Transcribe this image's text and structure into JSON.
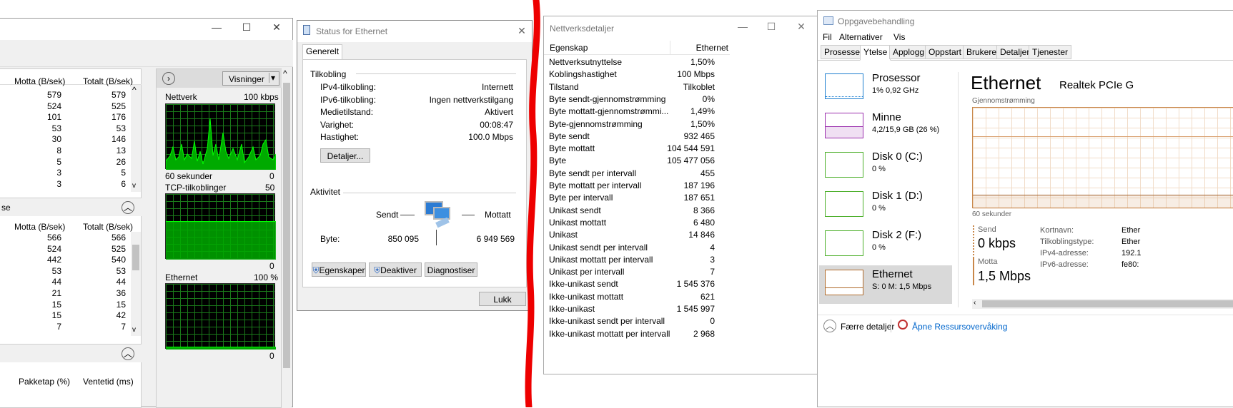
{
  "resmon": {
    "top_table": {
      "headers": [
        "Motta (B/sek)",
        "Totalt (B/sek)"
      ],
      "rows": [
        [
          "579",
          "579"
        ],
        [
          "524",
          "525"
        ],
        [
          "101",
          "176"
        ],
        [
          "53",
          "53"
        ],
        [
          "30",
          "146"
        ],
        [
          "8",
          "13"
        ],
        [
          "5",
          "26"
        ],
        [
          "3",
          "5"
        ],
        [
          "3",
          "6"
        ]
      ]
    },
    "mid_section": {
      "title_fragment": "se",
      "headers": [
        "Motta (B/sek)",
        "Totalt (B/sek)"
      ],
      "rows": [
        [
          "566",
          "566"
        ],
        [
          "524",
          "525"
        ],
        [
          "442",
          "540"
        ],
        [
          "53",
          "53"
        ],
        [
          "44",
          "44"
        ],
        [
          "21",
          "36"
        ],
        [
          "15",
          "15"
        ],
        [
          "15",
          "42"
        ],
        [
          "7",
          "7"
        ]
      ]
    },
    "bottom_headers": [
      "Pakketap (%)",
      "Ventetid (ms)"
    ],
    "views_button": "Visninger",
    "graphs": [
      {
        "title": "Nettverk",
        "scale": "100 kbps",
        "footer_left": "60 sekunder",
        "footer_right": "0"
      },
      {
        "title": "TCP-tilkoblinger",
        "scale": "50",
        "footer_right": "0"
      },
      {
        "title": "Ethernet",
        "scale": "100 %",
        "footer_right": "0"
      }
    ]
  },
  "status": {
    "title": "Status for Ethernet",
    "tab": "Generelt",
    "connection_heading": "Tilkobling",
    "fields": [
      {
        "label": "IPv4-tilkobling:",
        "value": "Internett"
      },
      {
        "label": "IPv6-tilkobling:",
        "value": "Ingen nettverkstilgang"
      },
      {
        "label": "Medietilstand:",
        "value": "Aktivert"
      },
      {
        "label": "Varighet:",
        "value": "00:08:47"
      },
      {
        "label": "Hastighet:",
        "value": "100.0 Mbps"
      }
    ],
    "details_btn": "Detaljer...",
    "activity_heading": "Aktivitet",
    "sent_label": "Sendt",
    "recv_label": "Mottatt",
    "bytes_label": "Byte:",
    "bytes_sent": "850 095",
    "bytes_recv": "6 949 569",
    "btn_properties": "Egenskaper",
    "btn_disable": "Deaktiver",
    "btn_diagnose": "Diagnostiser",
    "btn_close": "Lukk"
  },
  "details": {
    "title": "Nettverksdetaljer",
    "col1": "Egenskap",
    "col2": "Ethernet",
    "rows": [
      [
        "Nettverksutnyttelse",
        "1,50%"
      ],
      [
        "Koblingshastighet",
        "100 Mbps"
      ],
      [
        "Tilstand",
        "Tilkoblet"
      ],
      [
        "Byte sendt-gjennomstrømming",
        "0%"
      ],
      [
        "Byte mottatt-gjennomstrømmi...",
        "1,49%"
      ],
      [
        "Byte-gjennomstrømming",
        "1,50%"
      ],
      [
        "Byte sendt",
        "932 465"
      ],
      [
        "Byte mottatt",
        "104 544 591"
      ],
      [
        "Byte",
        "105 477 056"
      ],
      [
        "Byte sendt per intervall",
        "455"
      ],
      [
        "Byte mottatt per intervall",
        "187 196"
      ],
      [
        "Byte per intervall",
        "187 651"
      ],
      [
        "Unikast sendt",
        "8 366"
      ],
      [
        "Unikast mottatt",
        "6 480"
      ],
      [
        "Unikast",
        "14 846"
      ],
      [
        "Unikast sendt per intervall",
        "4"
      ],
      [
        "Unikast mottatt per intervall",
        "3"
      ],
      [
        "Unikast per intervall",
        "7"
      ],
      [
        "Ikke-unikast sendt",
        "1 545 376"
      ],
      [
        "Ikke-unikast mottatt",
        "621"
      ],
      [
        "Ikke-unikast",
        "1 545 997"
      ],
      [
        "Ikke-unikast sendt per intervall",
        "0"
      ],
      [
        "Ikke-unikast mottatt per intervall",
        "2 968"
      ]
    ]
  },
  "taskmgr": {
    "title": "Oppgavebehandling",
    "menu": [
      "Fil",
      "Alternativer",
      "Vis"
    ],
    "tabs": [
      "Prosesser",
      "Ytelse",
      "Applogg",
      "Oppstart",
      "Brukere",
      "Detaljer",
      "Tjenester"
    ],
    "perf_items": [
      {
        "name": "Prosessor",
        "sub": "1% 0,92 GHz",
        "color": "#1e7fd0"
      },
      {
        "name": "Minne",
        "sub": "4,2/15,9 GB (26 %)",
        "color": "#9b2fae"
      },
      {
        "name": "Disk 0 (C:)",
        "sub": "0 %",
        "color": "#4caf2a"
      },
      {
        "name": "Disk 1 (D:)",
        "sub": "0 %",
        "color": "#4caf2a"
      },
      {
        "name": "Disk 2 (F:)",
        "sub": "0 %",
        "color": "#4caf2a"
      },
      {
        "name": "Ethernet",
        "sub": "S: 0 M: 1,5 Mbps",
        "color": "#b06a2a"
      }
    ],
    "heading": "Ethernet",
    "adapter": "Realtek PCIe G",
    "throughput_label": "Gjennomstrømming",
    "graph_footer": "60 sekunder",
    "send_label": "Send",
    "send_value": "0 kbps",
    "recv_label": "Motta",
    "recv_value": "1,5 Mbps",
    "info": [
      {
        "label": "Kortnavn:",
        "value": "Ether"
      },
      {
        "label": "Tilkoblingstype:",
        "value": "Ether"
      },
      {
        "label": "IPv4-adresse:",
        "value": "192.1"
      },
      {
        "label": "IPv6-adresse:",
        "value": "fe80:"
      }
    ],
    "fewer_details": "Færre detaljer",
    "open_resmon": "Åpne Ressursovervåking"
  },
  "colors": {
    "red_line": "#ee0000",
    "graph_green": "#00ff00",
    "link_blue": "#0066cc"
  }
}
